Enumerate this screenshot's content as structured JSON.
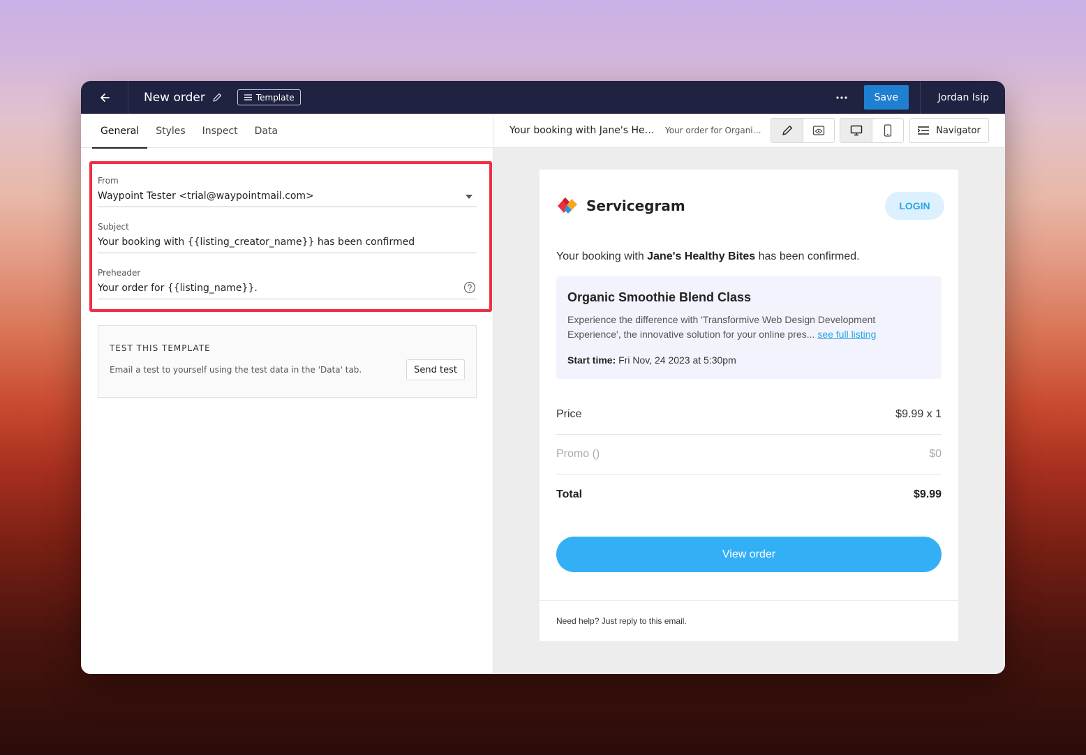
{
  "topbar": {
    "title": "New order",
    "template_label": "Template",
    "save_label": "Save",
    "user_name": "Jordan Isip"
  },
  "tabs": [
    {
      "label": "General",
      "active": true
    },
    {
      "label": "Styles",
      "active": false
    },
    {
      "label": "Inspect",
      "active": false
    },
    {
      "label": "Data",
      "active": false
    }
  ],
  "form": {
    "from_label": "From",
    "from_value": "Waypoint Tester <trial@waypointmail.com>",
    "subject_label": "Subject",
    "subject_value": "Your booking with {{listing_creator_name}} has been confirmed",
    "preheader_label": "Preheader",
    "preheader_value": "Your order for {{listing_name}}."
  },
  "test_template": {
    "title": "TEST THIS TEMPLATE",
    "description": "Email a test to yourself using the test data in the 'Data' tab.",
    "button_label": "Send test"
  },
  "preview_bar": {
    "subject": "Your booking with Jane's Healt...",
    "preheader": "Your order for Organic ...",
    "navigator_label": "Navigator"
  },
  "email": {
    "brand": "Servicegram",
    "login_label": "LOGIN",
    "intro_prefix": "Your booking with ",
    "intro_name": "Jane's Healthy Bites",
    "intro_suffix": " has been confirmed.",
    "listing_title": "Organic Smoothie Blend Class",
    "listing_description": "Experience the difference with 'Transformive Web Design Development Experience', the innovative solution for your online pres...",
    "see_full_listing": "see full listing",
    "start_label": "Start time:",
    "start_value": "Fri Nov, 24 2023 at 5:30pm",
    "price_label": "Price",
    "price_value": "$9.99 x 1",
    "promo_label": "Promo ()",
    "promo_value": "$0",
    "total_label": "Total",
    "total_value": "$9.99",
    "view_order_label": "View order",
    "footer_text": "Need help? Just reply to this email."
  },
  "colors": {
    "topbar_bg": "#1f2240",
    "save_button": "#1f7fd1",
    "highlight_border": "#ed3044",
    "accent": "#33b0f5"
  }
}
